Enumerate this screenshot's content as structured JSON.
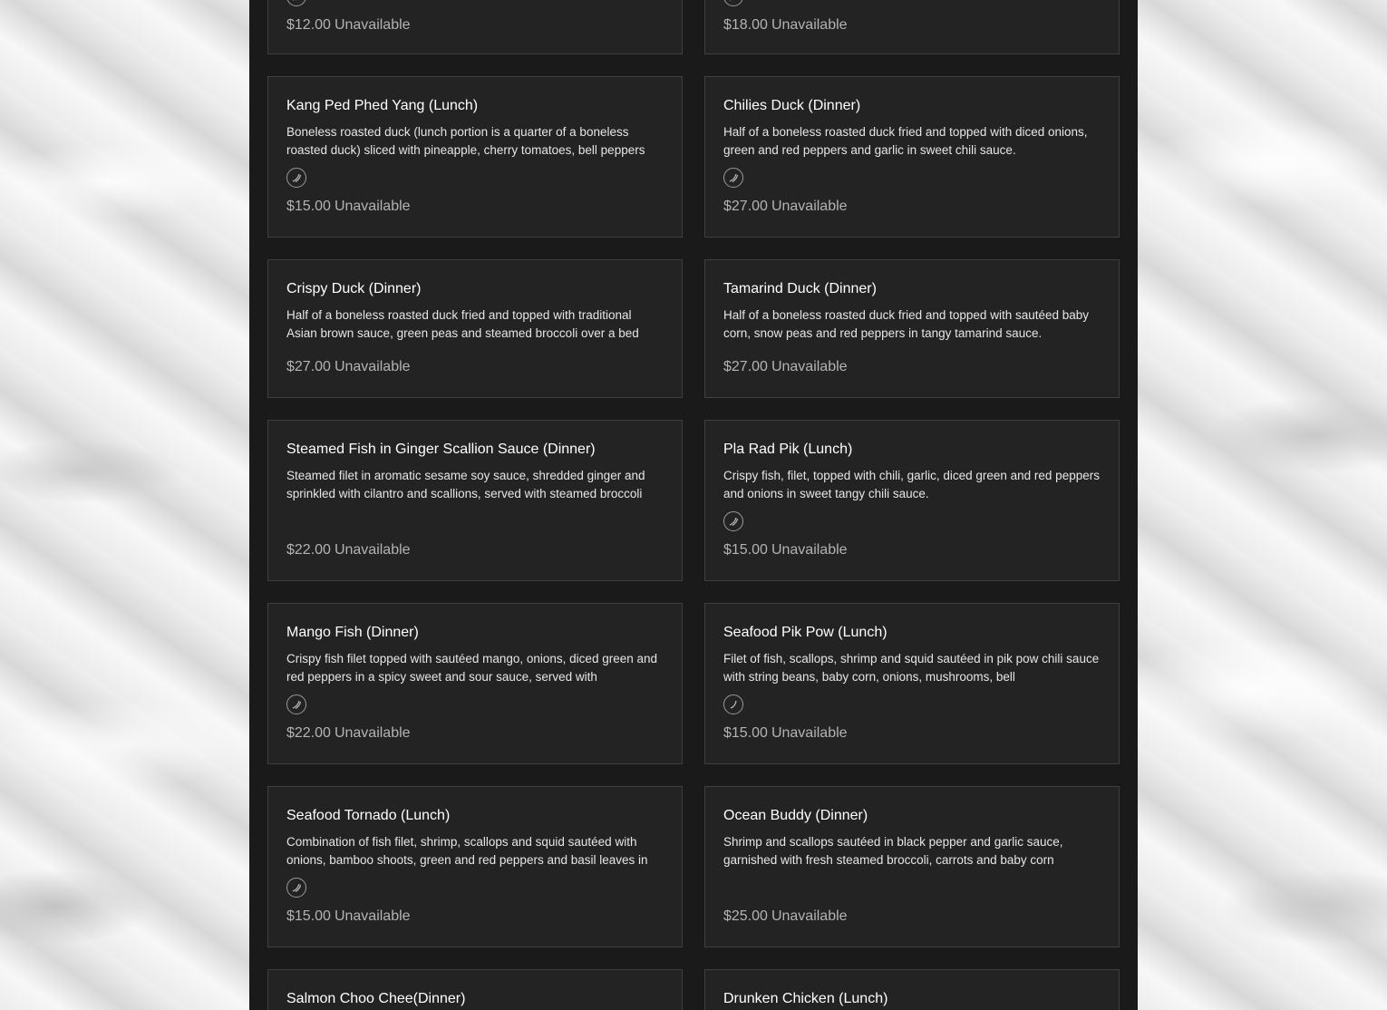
{
  "menu": {
    "status_label": "Unavailable",
    "rows": [
      [
        {
          "price": "$12.00"
        },
        {
          "price": "$18.00"
        }
      ],
      [
        {
          "name": "Kang Ped Phed Yang (Lunch)",
          "description": "Boneless roasted duck (lunch portion is a quarter of a boneless roasted duck) sliced with pineapple, cherry tomatoes, bell peppers",
          "price": "$15.00",
          "spice_icon": "chili-icon"
        },
        {
          "name": "Chilies Duck (Dinner)",
          "description": "Half of a boneless roasted duck fried and topped with diced onions, green and red peppers and garlic in sweet chili sauce.",
          "price": "$27.00",
          "spice_icon": "chili-icon"
        }
      ],
      [
        {
          "name": "Crispy Duck (Dinner)",
          "description": "Half of a boneless roasted duck fried and topped with traditional Asian brown sauce, green peas and steamed broccoli over a bed",
          "price": "$27.00"
        },
        {
          "name": "Tamarind Duck (Dinner)",
          "description": "Half of a boneless roasted duck fried and topped with sautéed baby corn, snow peas and red peppers in tangy tamarind sauce.",
          "price": "$27.00"
        }
      ],
      [
        {
          "name": "Steamed Fish in Ginger Scallion Sauce (Dinner)",
          "description": "Steamed filet in aromatic sesame soy sauce, shredded ginger and sprinkled with cilantro and scallions, served with steamed broccoli",
          "price": "$22.00"
        },
        {
          "name": "Pla Rad Pik (Lunch)",
          "description": "Crispy fish, filet, topped with chili, garlic, diced green and red peppers and onions in sweet tangy chili sauce.",
          "price": "$15.00",
          "spice_icon": "chili-icon"
        }
      ],
      [
        {
          "name": "Mango Fish (Dinner)",
          "description": "Crispy fish filet topped with sautéed mango, onions, diced green and red peppers in a spicy sweet and sour sauce, served with",
          "price": "$22.00",
          "spice_icon": "chili-icon"
        },
        {
          "name": "Seafood Pik Pow (Lunch)",
          "description": "Filet of fish, scallops, shrimp and squid sautéed in pik pow chili sauce with string beans, baby corn, onions, mushrooms, bell",
          "price": "$15.00",
          "spice_icon": "mild-chili-icon"
        }
      ],
      [
        {
          "name": "Seafood Tornado (Lunch)",
          "description": "Combination of fish filet, shrimp, scallops and squid sautéed with onions, bamboo shoots, green and red peppers and basil leaves in",
          "price": "$15.00",
          "spice_icon": "chili-icon"
        },
        {
          "name": "Ocean Buddy (Dinner)",
          "description": "Shrimp and scallops sautéed in black pepper and garlic sauce, garnished with fresh steamed broccoli, carrots and baby corn",
          "price": "$25.00"
        }
      ],
      [
        {
          "name": "Salmon Choo Chee(Dinner)"
        },
        {
          "name": "Drunken Chicken (Lunch)"
        }
      ]
    ]
  },
  "colors": {
    "panel": "#1a1a1a",
    "card": "#232323",
    "card_border": "#3f3f3f",
    "title": "#ffffff",
    "price": "#b3b3b3"
  }
}
